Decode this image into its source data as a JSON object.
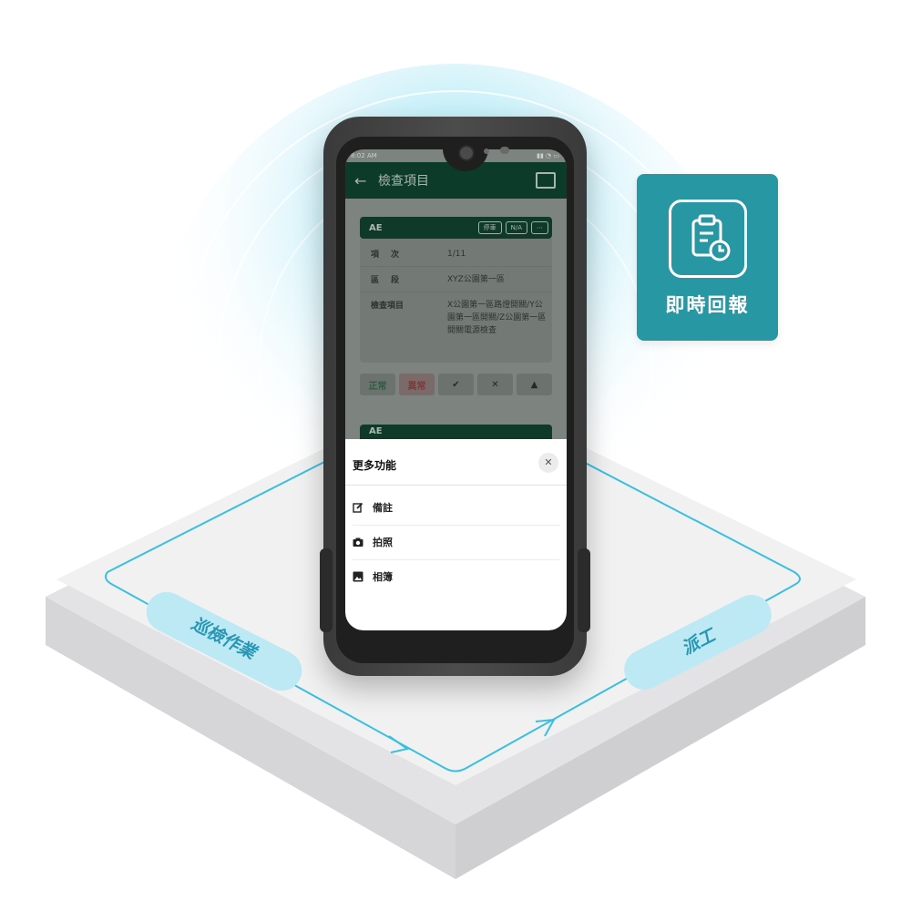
{
  "colors": {
    "teal": "#2897a4",
    "cyan_line": "#3bbfe0",
    "pill_bg": "#bde9f5",
    "app_green": "#0c3b29"
  },
  "app": {
    "status_time": "8:02 AM",
    "title": "檢查項目",
    "card": {
      "code": "AE",
      "chips": [
        "停車",
        "N/A",
        "⋯"
      ],
      "rows": [
        {
          "key": "項　次",
          "value": "1/11"
        },
        {
          "key": "區　段",
          "value": "XYZ公園第一區"
        },
        {
          "key": "檢查項目",
          "value": "X公園第一區路燈開關/Y公園第一區開關/Z公園第一區開關電源檢查"
        }
      ],
      "actions": [
        "正常",
        "異常",
        "✔",
        "✕",
        "▲"
      ]
    },
    "card2_code": "AE"
  },
  "sheet": {
    "title": "更多功能",
    "close": "✕",
    "items": [
      {
        "icon": "edit-icon",
        "label": "備註"
      },
      {
        "icon": "camera-icon",
        "label": "拍照"
      },
      {
        "icon": "image-icon",
        "label": "相簿"
      }
    ]
  },
  "tile": {
    "label": "即時回報",
    "icon": "clipboard-clock-icon"
  },
  "labels": {
    "patrol": "巡檢作業",
    "dispatch": "派工"
  }
}
